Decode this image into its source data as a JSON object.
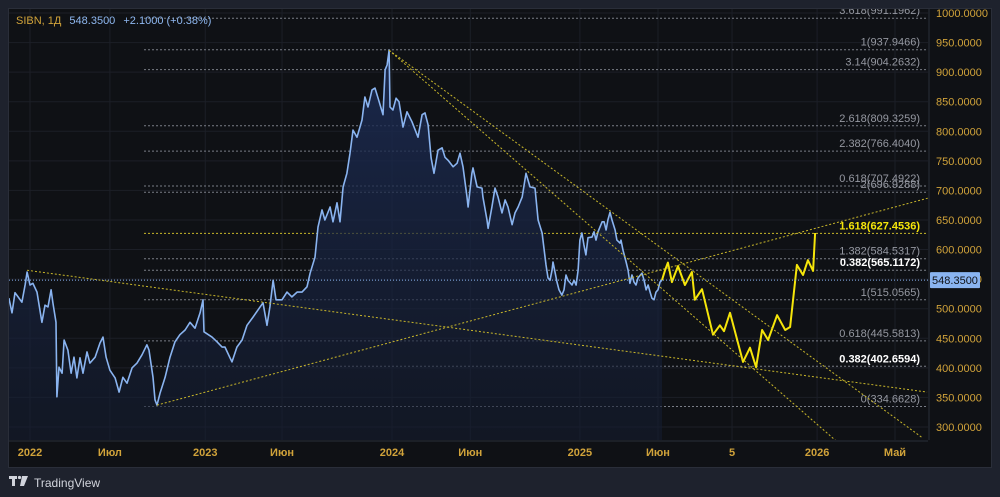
{
  "header": {
    "symbol": "SIBN, 1Д",
    "price": "548.3500",
    "change": "+2.1000 (+0.38%)"
  },
  "brand": {
    "logo": "17",
    "name": "TradingView"
  },
  "colors": {
    "price_line": "#8ab4f0",
    "forecast": "#f5e50a",
    "trendline": "#c8b62a",
    "axis_text": "#d1a33a",
    "fib_line": "#6b6f78",
    "current_price_bg": "#8ab4f0"
  },
  "chart_data": {
    "type": "line",
    "title": "SIBN, 1Д",
    "ylim": [
      290,
      1010
    ],
    "grid": true,
    "y_ticks": [
      {
        "value": 1000,
        "label": "1000.0000"
      },
      {
        "value": 950,
        "label": "950.0000"
      },
      {
        "value": 900,
        "label": "900.0000"
      },
      {
        "value": 850,
        "label": "850.0000"
      },
      {
        "value": 800,
        "label": "800.0000"
      },
      {
        "value": 750,
        "label": "750.0000"
      },
      {
        "value": 700,
        "label": "700.0000"
      },
      {
        "value": 650,
        "label": "650.0000"
      },
      {
        "value": 600,
        "label": "600.0000"
      },
      {
        "value": 550,
        "label": "550.0000"
      },
      {
        "value": 500,
        "label": "500.0000"
      },
      {
        "value": 450,
        "label": "450.0000"
      },
      {
        "value": 400,
        "label": "400.0000"
      },
      {
        "value": 350,
        "label": "350.0000"
      },
      {
        "value": 300,
        "label": "300.0000"
      }
    ],
    "x_ticks": [
      {
        "t": 2022.0,
        "label": "2022"
      },
      {
        "t": 2022.436,
        "label": "Июл"
      },
      {
        "t": 2022.956,
        "label": "2023"
      },
      {
        "t": 2023.375,
        "label": "Июн"
      },
      {
        "t": 2023.975,
        "label": "2024"
      },
      {
        "t": 2024.402,
        "label": "Июн"
      },
      {
        "t": 2025.0,
        "label": "2025"
      },
      {
        "t": 2025.426,
        "label": "Июн"
      },
      {
        "t": 2025.83,
        "label": "5"
      },
      {
        "t": 2026.294,
        "label": "2026"
      },
      {
        "t": 2026.719,
        "label": "Май"
      }
    ],
    "current_price": {
      "value": 548.35,
      "label": "548.3500"
    },
    "series": [
      {
        "name": "SIBN",
        "points": [
          [
            2021.885,
            518
          ],
          [
            2021.902,
            493
          ],
          [
            2021.918,
            527
          ],
          [
            2021.935,
            520
          ],
          [
            2021.956,
            511
          ],
          [
            2021.973,
            540
          ],
          [
            2021.984,
            562
          ],
          [
            2022.0,
            540
          ],
          [
            2022.016,
            543
          ],
          [
            2022.038,
            528
          ],
          [
            2022.065,
            477
          ],
          [
            2022.082,
            506
          ],
          [
            2022.098,
            503
          ],
          [
            2022.115,
            532
          ],
          [
            2022.125,
            510
          ],
          [
            2022.142,
            477
          ],
          [
            2022.147,
            351
          ],
          [
            2022.158,
            401
          ],
          [
            2022.175,
            391
          ],
          [
            2022.186,
            447
          ],
          [
            2022.207,
            430
          ],
          [
            2022.224,
            391
          ],
          [
            2022.24,
            418
          ],
          [
            2022.256,
            383
          ],
          [
            2022.273,
            417
          ],
          [
            2022.289,
            391
          ],
          [
            2022.311,
            427
          ],
          [
            2022.327,
            408
          ],
          [
            2022.355,
            418
          ],
          [
            2022.382,
            442
          ],
          [
            2022.398,
            452
          ],
          [
            2022.415,
            418
          ],
          [
            2022.436,
            396
          ],
          [
            2022.464,
            383
          ],
          [
            2022.486,
            359
          ],
          [
            2022.507,
            384
          ],
          [
            2022.529,
            374
          ],
          [
            2022.557,
            400
          ],
          [
            2022.584,
            408
          ],
          [
            2022.611,
            422
          ],
          [
            2022.638,
            439
          ],
          [
            2022.649,
            430
          ],
          [
            2022.671,
            384
          ],
          [
            2022.682,
            346
          ],
          [
            2022.693,
            337
          ],
          [
            2022.709,
            357
          ],
          [
            2022.737,
            384
          ],
          [
            2022.764,
            418
          ],
          [
            2022.791,
            444
          ],
          [
            2022.818,
            456
          ],
          [
            2022.846,
            464
          ],
          [
            2022.873,
            477
          ],
          [
            2022.9,
            467
          ],
          [
            2022.928,
            493
          ],
          [
            2022.944,
            515
          ],
          [
            2022.949,
            461
          ],
          [
            2022.993,
            452
          ],
          [
            2023.02,
            444
          ],
          [
            2023.048,
            435
          ],
          [
            2023.064,
            435
          ],
          [
            2023.091,
            417
          ],
          [
            2023.102,
            410
          ],
          [
            2023.129,
            435
          ],
          [
            2023.157,
            447
          ],
          [
            2023.184,
            472
          ],
          [
            2023.217,
            486
          ],
          [
            2023.244,
            498
          ],
          [
            2023.271,
            510
          ],
          [
            2023.293,
            472
          ],
          [
            2023.309,
            503
          ],
          [
            2023.326,
            548
          ],
          [
            2023.342,
            515
          ],
          [
            2023.375,
            515
          ],
          [
            2023.402,
            528
          ],
          [
            2023.429,
            520
          ],
          [
            2023.457,
            528
          ],
          [
            2023.484,
            528
          ],
          [
            2023.511,
            537
          ],
          [
            2023.528,
            560
          ],
          [
            2023.555,
            587
          ],
          [
            2023.571,
            638
          ],
          [
            2023.593,
            667
          ],
          [
            2023.609,
            650
          ],
          [
            2023.637,
            672
          ],
          [
            2023.653,
            647
          ],
          [
            2023.675,
            679
          ],
          [
            2023.691,
            647
          ],
          [
            2023.708,
            706
          ],
          [
            2023.729,
            729
          ],
          [
            2023.746,
            763
          ],
          [
            2023.762,
            802
          ],
          [
            2023.784,
            790
          ],
          [
            2023.811,
            819
          ],
          [
            2023.827,
            858
          ],
          [
            2023.844,
            841
          ],
          [
            2023.866,
            870
          ],
          [
            2023.882,
            873
          ],
          [
            2023.899,
            856
          ],
          [
            2023.926,
            828
          ],
          [
            2023.937,
            904
          ],
          [
            2023.948,
            912
          ],
          [
            2023.959,
            937
          ],
          [
            2023.964,
            841
          ],
          [
            2023.98,
            836
          ],
          [
            2023.997,
            856
          ],
          [
            2024.013,
            850
          ],
          [
            2024.035,
            807
          ],
          [
            2024.057,
            833
          ],
          [
            2024.084,
            816
          ],
          [
            2024.117,
            790
          ],
          [
            2024.139,
            828
          ],
          [
            2024.155,
            831
          ],
          [
            2024.172,
            811
          ],
          [
            2024.188,
            755
          ],
          [
            2024.204,
            729
          ],
          [
            2024.226,
            768
          ],
          [
            2024.248,
            772
          ],
          [
            2024.264,
            756
          ],
          [
            2024.281,
            751
          ],
          [
            2024.308,
            740
          ],
          [
            2024.33,
            746
          ],
          [
            2024.346,
            763
          ],
          [
            2024.362,
            740
          ],
          [
            2024.384,
            689
          ],
          [
            2024.39,
            672
          ],
          [
            2024.411,
            729
          ],
          [
            2024.417,
            738
          ],
          [
            2024.439,
            706
          ],
          [
            2024.466,
            704
          ],
          [
            2024.471,
            689
          ],
          [
            2024.493,
            650
          ],
          [
            2024.499,
            636
          ],
          [
            2024.52,
            672
          ],
          [
            2024.537,
            704
          ],
          [
            2024.553,
            689
          ],
          [
            2024.575,
            662
          ],
          [
            2024.592,
            684
          ],
          [
            2024.608,
            672
          ],
          [
            2024.63,
            642
          ],
          [
            2024.646,
            662
          ],
          [
            2024.663,
            672
          ],
          [
            2024.685,
            689
          ],
          [
            2024.706,
            729
          ],
          [
            2024.728,
            706
          ],
          [
            2024.755,
            704
          ],
          [
            2024.772,
            650
          ],
          [
            2024.794,
            628
          ],
          [
            2024.815,
            574
          ],
          [
            2024.826,
            552
          ],
          [
            2024.837,
            548
          ],
          [
            2024.848,
            565
          ],
          [
            2024.853,
            579
          ],
          [
            2024.864,
            562
          ],
          [
            2024.875,
            545
          ],
          [
            2024.886,
            532
          ],
          [
            2024.902,
            523
          ],
          [
            2024.913,
            532
          ],
          [
            2024.924,
            557
          ],
          [
            2024.935,
            548
          ],
          [
            2024.957,
            540
          ],
          [
            2024.968,
            548
          ],
          [
            2024.979,
            540
          ],
          [
            2024.99,
            565
          ],
          [
            2025.0,
            616
          ],
          [
            2025.011,
            628
          ],
          [
            2025.022,
            608
          ],
          [
            2025.033,
            591
          ],
          [
            2025.044,
            620
          ],
          [
            2025.066,
            621
          ],
          [
            2025.077,
            630
          ],
          [
            2025.088,
            616
          ],
          [
            2025.099,
            630
          ],
          [
            2025.121,
            647
          ],
          [
            2025.132,
            647
          ],
          [
            2025.143,
            633
          ],
          [
            2025.153,
            650
          ],
          [
            2025.164,
            663
          ],
          [
            2025.175,
            650
          ],
          [
            2025.192,
            633
          ],
          [
            2025.202,
            616
          ],
          [
            2025.219,
            611
          ],
          [
            2025.224,
            616
          ],
          [
            2025.235,
            599
          ],
          [
            2025.252,
            579
          ],
          [
            2025.263,
            565
          ],
          [
            2025.273,
            543
          ],
          [
            2025.284,
            557
          ],
          [
            2025.295,
            545
          ],
          [
            2025.306,
            540
          ],
          [
            2025.317,
            552
          ],
          [
            2025.339,
            560
          ],
          [
            2025.35,
            548
          ],
          [
            2025.361,
            532
          ],
          [
            2025.372,
            540
          ],
          [
            2025.383,
            528
          ],
          [
            2025.393,
            518
          ],
          [
            2025.404,
            515
          ],
          [
            2025.415,
            528
          ],
          [
            2025.426,
            532
          ],
          [
            2025.437,
            545
          ],
          [
            2025.448,
            548.35
          ]
        ]
      },
      {
        "name": "forecast",
        "points": [
          [
            2025.448,
            548.35
          ],
          [
            2025.464,
            565
          ],
          [
            2025.48,
            578
          ],
          [
            2025.502,
            545
          ],
          [
            2025.535,
            572
          ],
          [
            2025.573,
            540
          ],
          [
            2025.611,
            562
          ],
          [
            2025.627,
            515
          ],
          [
            2025.666,
            533
          ],
          [
            2025.726,
            456
          ],
          [
            2025.764,
            472
          ],
          [
            2025.786,
            462
          ],
          [
            2025.819,
            493
          ],
          [
            2025.89,
            410
          ],
          [
            2025.928,
            434
          ],
          [
            2025.961,
            401
          ],
          [
            2025.994,
            464
          ],
          [
            2026.027,
            447
          ],
          [
            2026.076,
            489
          ],
          [
            2026.12,
            464
          ],
          [
            2026.147,
            469
          ],
          [
            2026.184,
            574
          ],
          [
            2026.217,
            557
          ],
          [
            2026.244,
            582
          ],
          [
            2026.272,
            564
          ],
          [
            2026.283,
            628
          ]
        ]
      }
    ],
    "fib_levels": [
      {
        "value": 991.1962,
        "label": "3.618(991.1962)",
        "style": "gray"
      },
      {
        "value": 937.9466,
        "label": "1(937.9466)",
        "style": "gray"
      },
      {
        "value": 904.2632,
        "label": "3.14(904.2632)",
        "style": "gray"
      },
      {
        "value": 809.3259,
        "label": "2.618(809.3259)",
        "style": "gray"
      },
      {
        "value": 766.404,
        "label": "2.382(766.4040)",
        "style": "gray"
      },
      {
        "value": 707.4922,
        "label": "0.618(707.4922)",
        "style": "gray"
      },
      {
        "value": 696.9288,
        "label": "2(696.9288)",
        "style": "gray"
      },
      {
        "value": 627.4536,
        "label": "1.618(627.4536)",
        "style": "yellow"
      },
      {
        "value": 584.5317,
        "label": "1.382(584.5317)",
        "style": "gray"
      },
      {
        "value": 565.1172,
        "label": "0.382(565.1172)",
        "style": "white"
      },
      {
        "value": 515.0565,
        "label": "1(515.0565)",
        "style": "gray"
      },
      {
        "value": 445.5813,
        "label": "0.618(445.5813)",
        "style": "gray"
      },
      {
        "value": 402.6594,
        "label": "0.382(402.6594)",
        "style": "white"
      },
      {
        "value": 334.6628,
        "label": "0(334.6628)",
        "style": "gray"
      }
    ],
    "fib_start_t": 2022.622,
    "trendlines": [
      {
        "from": [
          2021.984,
          565
        ],
        "to": [
          2026.894,
          359
        ]
      },
      {
        "from": [
          2022.693,
          337
        ],
        "to": [
          2026.899,
          687
        ]
      },
      {
        "from": [
          2023.959,
          937
        ],
        "to": [
          2026.872,
          281
        ]
      },
      {
        "from": [
          2023.959,
          937
        ],
        "to": [
          2026.403,
          275
        ]
      }
    ]
  }
}
